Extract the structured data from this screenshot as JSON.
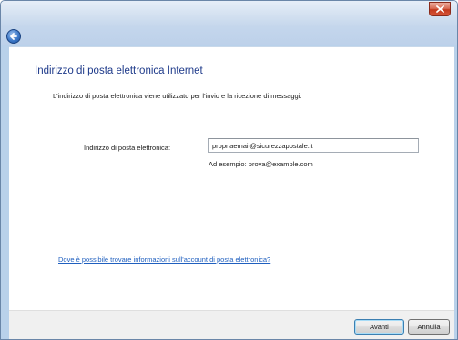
{
  "titlebar": {
    "close_icon": "close-icon",
    "back_icon": "back-arrow-icon"
  },
  "page": {
    "heading": "Indirizzo di posta elettronica Internet",
    "description": "L'indirizzo di posta elettronica viene utilizzato per l'invio e la ricezione di messaggi."
  },
  "form": {
    "email_label": "Indirizzo di posta elettronica:",
    "email_value": "propriaemail@sicurezzapostale.it",
    "example_text": "Ad esempio: prova@example.com"
  },
  "help": {
    "link_text": "Dove è possibile trovare informazioni sull'account di posta elettronica?"
  },
  "footer": {
    "next_label": "Avanti",
    "cancel_label": "Annulla"
  },
  "colors": {
    "heading": "#1e3a8a",
    "link": "#1f5fbf",
    "close_button": "#c2391d",
    "frame": "#b9d1ea"
  }
}
